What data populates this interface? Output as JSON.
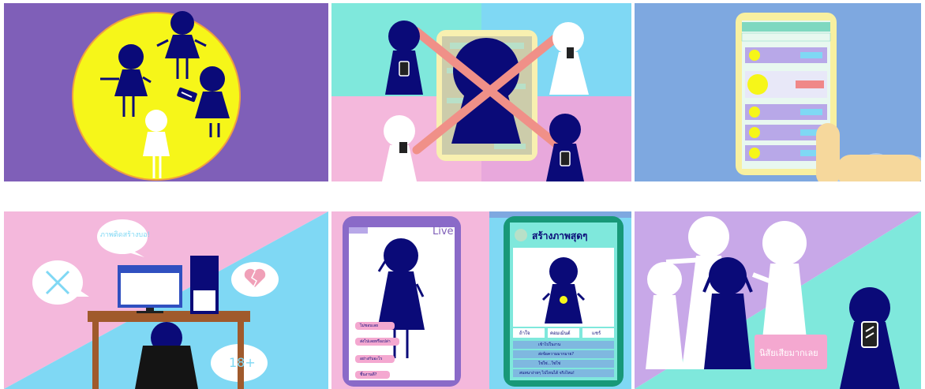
{
  "colors": {
    "navy": "#0a0a78",
    "purple": "#7f5fb8",
    "yellow": "#f6f619",
    "mint": "#7fe8dc",
    "cyan": "#7fd8f4",
    "pink": "#f4b8dc",
    "lavender": "#c8a8e8",
    "blue": "#7ea8e0",
    "green_frame": "#189878"
  },
  "panel1": {
    "icons": [
      "phone-icon"
    ]
  },
  "panel2": {
    "icons": [
      "cross-mark-icon",
      "phone-icon"
    ]
  },
  "panel3": {
    "icons": [
      "hand-icon",
      "cloud-icon"
    ]
  },
  "panel4": {
    "bubble_top_text": "ภาพติดสร้างบอ!",
    "bubble_age_text": "18+",
    "icons": [
      "cross-icon",
      "broken-heart-icon",
      "computer-icon"
    ]
  },
  "panel5": {
    "live_label": "Live",
    "profile_title": "สร้างภาพสุดๆ",
    "tabs": [
      "ถ้าใจ",
      "คอมเม้นต์",
      "แชร์"
    ],
    "menu_items": [
      "เข้าไปในงาน",
      "ส่งข้อความมากมาย?",
      "ใช่ใช่...ใช่ใช่",
      "สนทนาง่ายๆ ไปไหนได้ จริงไหม!"
    ],
    "chat_tags": [
      "ไม่ชอบเลย",
      "ส่งไปเลยหรือเปล่า",
      "อย่างกับอะไร",
      "ชิ้นงานดี?"
    ]
  },
  "panel6": {
    "sign_text": "นิสัยเสียมากเลย",
    "icons": [
      "phone-icon"
    ]
  }
}
